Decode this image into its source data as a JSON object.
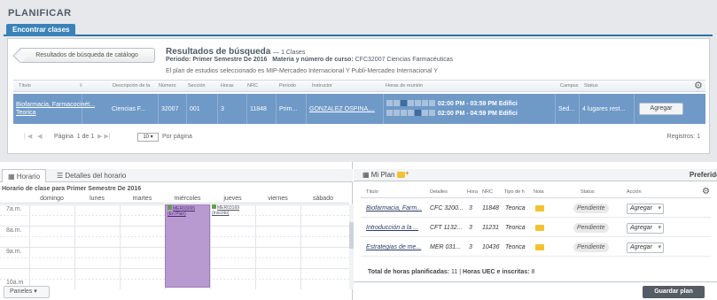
{
  "page_title": "PLANIFICAR",
  "tab_label": "Encontrar clases",
  "back_button": "Resultados de búsqueda de catálogo",
  "results": {
    "title": "Resultados de búsqueda",
    "count": "— 1 Clases",
    "period_label": "Periodo:",
    "period_value": "Primer Semestre De 2016",
    "subject_label": "Materia y número de curso:",
    "subject_value": "CFC32007 Ciencias Farmacéuticas",
    "plan_note": "El plan de estudios seleccionado es MIP-Mercadeo Internacional Y Publi-Mercadeo Internacional Y"
  },
  "table": {
    "headers": [
      "Título",
      "Descripción de la",
      "Número",
      "Sección",
      "Horas",
      "NRC",
      "Periodo",
      "Instructor",
      "Horas de reunión",
      "Campus",
      "Status"
    ],
    "row": {
      "title_line1": "Biofarmacia, Farmacocinét...",
      "title_line2": "Teorica",
      "description": "Ciencias F...",
      "number": "32007",
      "section": "001",
      "hours": "3",
      "nrc": "11848",
      "period": "Prim...",
      "instructor": "GONZALEZ OSPINA,...",
      "meeting_days": [
        "D",
        "L",
        "M",
        "M",
        "J",
        "V",
        "S"
      ],
      "meeting1": "02:00 PM - 03:59 PM Edifici",
      "meeting2": "02:00 PM - 04:59 PM Edifici",
      "campus": "Sed...",
      "status": "4 lugares rest...",
      "action": "Agregar"
    }
  },
  "pager": {
    "page_label": "Página",
    "page_value": "1 de 1",
    "per_page": "10",
    "per_page_label": "Por página",
    "records": "Registros: 1"
  },
  "schedule": {
    "tab_horario": "Horario",
    "tab_detalles": "Detalles del horario",
    "caption": "Horario de clase para Primer Semestre De 2016",
    "days": [
      "domingo",
      "lunes",
      "martes",
      "miércoles",
      "jueves",
      "viernes",
      "sábado"
    ],
    "hours": [
      "7a.m.",
      "8a.m.",
      "9a.m.",
      "10a.m"
    ],
    "event1_line1": "MER03065",
    "event1_line2": "(En Plan)",
    "event2_line1": "MER03169",
    "event2_line2": "(Inscrito)",
    "paneles": "Paneles"
  },
  "plan": {
    "title": "Mi Plan",
    "preferences": "Preferido",
    "headers": [
      "Título",
      "Detalles",
      "Hora",
      "NRC",
      "Tipo de h",
      "Nota",
      "Status",
      "Acción"
    ],
    "rows": [
      {
        "title": "Biofarmacia, Farm...",
        "details": "CFC 3200...",
        "hours": "3",
        "nrc": "11848",
        "type": "Teorica",
        "status": "Pendiente",
        "action": "Agregar"
      },
      {
        "title": "Introducción a la ...",
        "details": "CFT 1132...",
        "hours": "3",
        "nrc": "11231",
        "type": "Teorica",
        "status": "Pendiente",
        "action": "Agregar"
      },
      {
        "title": "Estrategias de me...",
        "details": "MER 031...",
        "hours": "3",
        "nrc": "10436",
        "type": "Teorica",
        "status": "Pendiente",
        "action": "Agregar"
      }
    ],
    "total_label": "Total de horas planificadas:",
    "total_value": "11",
    "total_sep": "|",
    "total_label2": "Horas UEC e inscritas:",
    "total_value2": "8",
    "save_button": "Guardar plan"
  }
}
